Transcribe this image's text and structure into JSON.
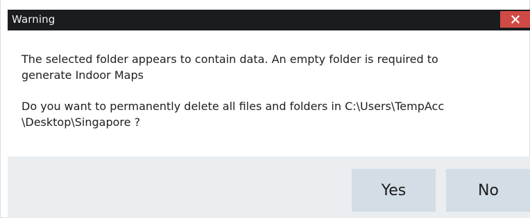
{
  "window": {
    "title": "Warning",
    "close_icon": "close-icon"
  },
  "message": {
    "line1": "The selected folder appears to contain data. An empty folder is required to\ngenerate Indoor Maps",
    "line2": "Do you want to permanently delete all files and folders in C:\\Users\\TempAcc\n\\Desktop\\Singapore ?"
  },
  "buttons": {
    "yes_label": "Yes",
    "no_label": "No"
  },
  "colors": {
    "titlebar_bg": "#1a1c1f",
    "close_bg": "#cf4a45",
    "footer_bg": "#eaeef1",
    "button_bg": "#d3dde5"
  }
}
